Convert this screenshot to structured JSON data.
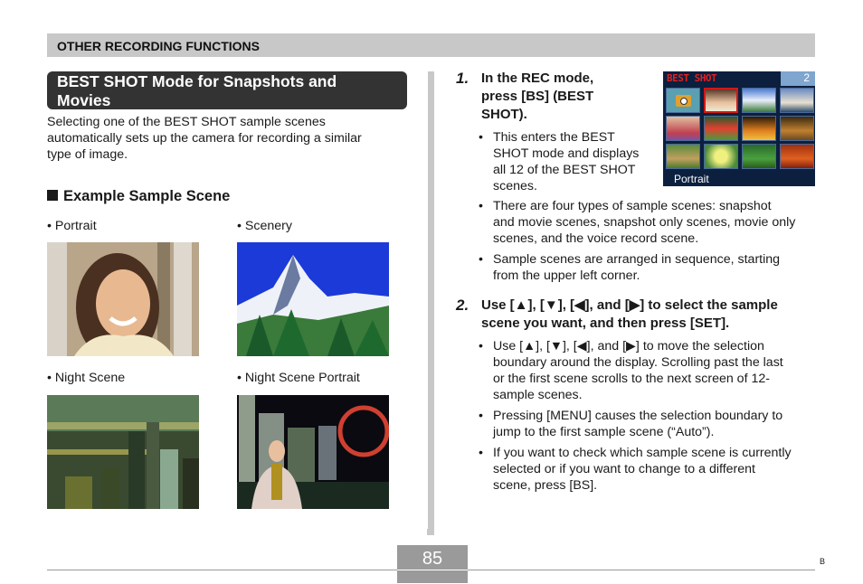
{
  "header": {
    "section": "OTHER RECORDING FUNCTIONS"
  },
  "left": {
    "title_line1": "BEST SHOT Mode for Snapshots and",
    "title_line2": "Movies",
    "intro_lines": [
      "Selecting one of the BEST SHOT sample scenes",
      "automatically sets up the camera for recording a similar",
      "type of image."
    ],
    "example_heading": "Example Sample Scene",
    "examples": [
      {
        "label": "• Portrait",
        "image": "portrait-photo"
      },
      {
        "label": "• Scenery",
        "image": "scenery-photo"
      },
      {
        "label": "• Night Scene",
        "image": "night-scene-photo"
      },
      {
        "label": "• Night Scene Portrait",
        "image": "night-scene-portrait-photo"
      }
    ]
  },
  "right": {
    "step1": {
      "num": "1.",
      "lines": [
        "In the REC mode,",
        "press [BS] (BEST",
        "SHOT)."
      ],
      "bullets": [
        [
          "This enters the BEST",
          "SHOT mode and displays",
          "all 12 of the BEST SHOT",
          "scenes."
        ],
        [
          "There are four types of sample scenes: snapshot",
          "and movie scenes, snapshot only scenes, movie only",
          "scenes, and the voice record scene."
        ],
        [
          "Sample scenes are arranged in sequence, starting",
          "from the upper left corner."
        ]
      ]
    },
    "step2": {
      "num": "2.",
      "lines": [
        "Use [▲], [▼], [◀], and [▶] to select the sample",
        "scene you want, and then press [SET]."
      ],
      "bullets": [
        [
          "Use [▲], [▼], [◀], and [▶] to move the selection",
          "boundary around the display. Scrolling past the last",
          "or the first scene scrolls to the next screen of 12-",
          "sample scenes."
        ],
        [
          "Pressing [MENU] causes the selection boundary to",
          "jump to the first sample scene (“Auto”)."
        ],
        [
          "If you want to check which sample scene is currently",
          "selected or if you want to change to a different",
          "scene, press [BS]."
        ]
      ]
    },
    "lcd": {
      "title": "BEST SHOT",
      "page": "2",
      "selected_label": "Portrait",
      "title_color": "#e02020",
      "selection_color": "#d01818",
      "cells": [
        "camera-icon-cell",
        "portrait",
        "mountain",
        "ship-portrait",
        "children",
        "soccer",
        "fire",
        "party",
        "dog",
        "flower",
        "forest",
        "autumn"
      ]
    }
  },
  "footer": {
    "page_number": "85",
    "letter": "B"
  }
}
